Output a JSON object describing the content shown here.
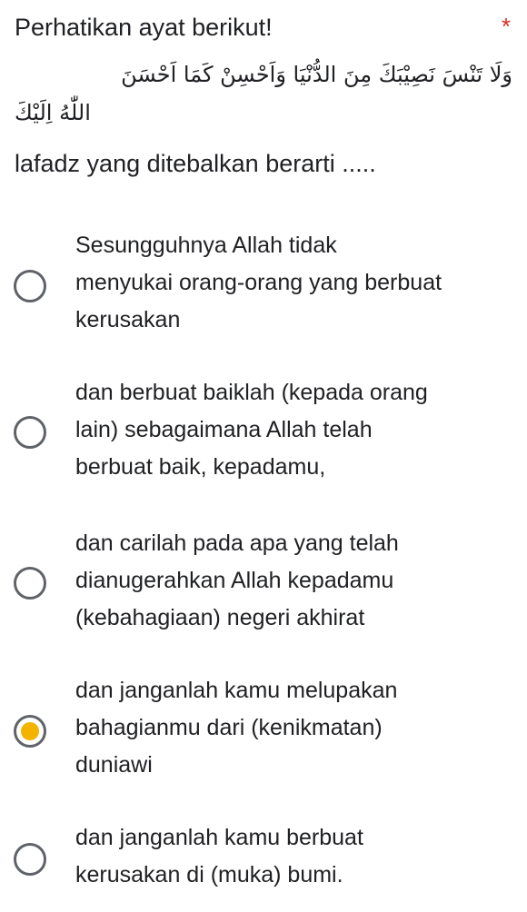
{
  "question": {
    "title": "Perhatikan ayat berikut!",
    "required_mark": "*",
    "arabic_line1": "وَلَا تَنْسَ نَصِيْبَكَ مِنَ الدُّنْيَا وَاَحْسِنْ كَمَا اَحْسَنَ",
    "arabic_line2": "اللّٰهُ اِلَيْكَ",
    "prompt": "lafadz yang ditebalkan berarti .....",
    "options": [
      {
        "lines": [
          "Sesungguhnya Allah tidak",
          "menyukai orang-orang yang berbuat",
          "kerusakan"
        ],
        "selected": false
      },
      {
        "lines": [
          "dan berbuat baiklah (kepada orang",
          "lain) sebagaimana Allah telah",
          "berbuat baik, kepadamu,"
        ],
        "selected": false
      },
      {
        "lines": [
          "dan carilah pada apa yang telah",
          "dianugerahkan Allah kepadamu",
          "(kebahagiaan) negeri akhirat"
        ],
        "selected": false
      },
      {
        "lines": [
          "dan janganlah kamu melupakan",
          "bahagianmu dari (kenikmatan)",
          "duniawi"
        ],
        "selected": true
      },
      {
        "lines": [
          "dan janganlah kamu berbuat",
          "kerusakan di (muka) bumi."
        ],
        "selected": false
      }
    ]
  },
  "colors": {
    "text": "#202124",
    "required": "#d93025",
    "radio_border": "#5f6368",
    "radio_selected_fill": "#f3b400"
  }
}
